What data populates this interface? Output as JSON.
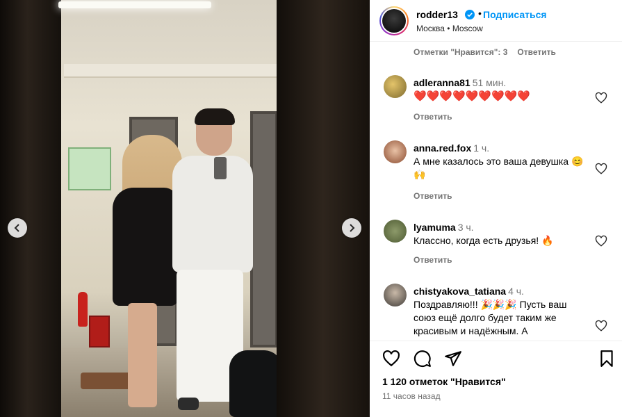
{
  "post": {
    "username": "rodder13",
    "follow_label": "Подписаться",
    "separator": "•",
    "location": "Москва • Moscow"
  },
  "comments_meta": {
    "likes_text": "Отметки \"Нравится\": 3",
    "reply_label": "Ответить"
  },
  "comments": [
    {
      "user": "adleranna81",
      "time": "51 мин.",
      "text": "❤️❤️❤️❤️❤️❤️❤️❤️❤️",
      "reply": "Ответить"
    },
    {
      "user": "anna.red.fox",
      "time": "1 ч.",
      "text": "А мне казалось это ваша девушка 😊🙌",
      "reply": "Ответить"
    },
    {
      "user": "lyamuma",
      "time": "3 ч.",
      "text": "Классно, когда есть друзья! 🔥",
      "reply": "Ответить"
    },
    {
      "user": "chistyakova_tatiana",
      "time": "4 ч.",
      "text": "Поздравляю!!! 🎉🎉🎉 Пусть ваш союз ещё долго будет таким же красивым и надёжным. А"
    }
  ],
  "footer": {
    "likes": "1 120 отметок \"Нравится\"",
    "time_ago": "11 часов назад"
  },
  "icons": {
    "like": "heart-icon",
    "comment": "comment-icon",
    "share": "share-icon",
    "save": "bookmark-icon",
    "prev": "chevron-left-icon",
    "next": "chevron-right-icon",
    "verified": "verified-badge-icon"
  },
  "colors": {
    "accent": "#0095f6",
    "verified": "#0095f6",
    "muted": "#737373",
    "heart_red": "#ed1c24"
  }
}
